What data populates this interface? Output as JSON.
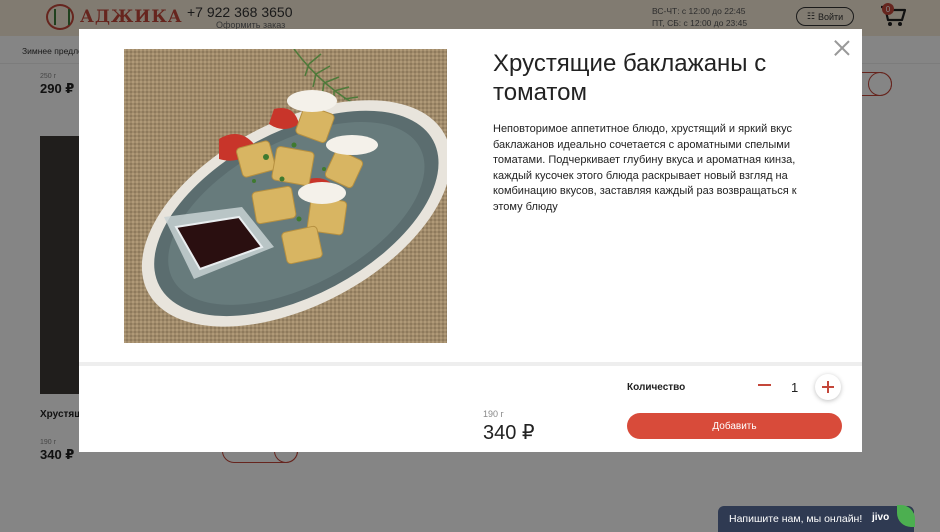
{
  "header": {
    "logo_text": "АДЖИКА",
    "phone": "+7 922 368 3650",
    "order_link": "Оформить заказ",
    "hours_line1": "ВС-ЧТ: с 12:00 до 22:45",
    "hours_line2": "ПТ, СБ: с 12:00 до 23:45",
    "login_label": "Войти",
    "cart_count": "0"
  },
  "nav": {
    "first_item": "Зимнее предло"
  },
  "background_cards": {
    "card1_weight": "250 г",
    "card1_price": "290 ₽",
    "card2_title": "Хрустящ",
    "card2_weight": "190 г",
    "card2_price": "340 ₽"
  },
  "modal": {
    "title": "Хрустящие баклажаны с томатом",
    "description": "Неповторимое аппетитное блюдо, хрустящий и яркий вкус баклажанов идеально сочетается с ароматными спелыми томатами. Подчеркивает глубину вкуса и ароматная кинза, каждый кусочек этого блюда раскрывает новый взгляд на комбинацию вкусов, заставляя каждый раз возвращаться к этому блюду",
    "weight": "190 г",
    "price": "340 ₽",
    "quantity_label": "Количество",
    "quantity": "1",
    "add_button": "Добавить"
  },
  "chat": {
    "text": "Напишите нам, мы онлайн!",
    "brand": "jivo"
  },
  "colors": {
    "accent": "#d84b3a",
    "header_bg": "#f7ecd9",
    "chat_bg": "#2f3a52"
  }
}
